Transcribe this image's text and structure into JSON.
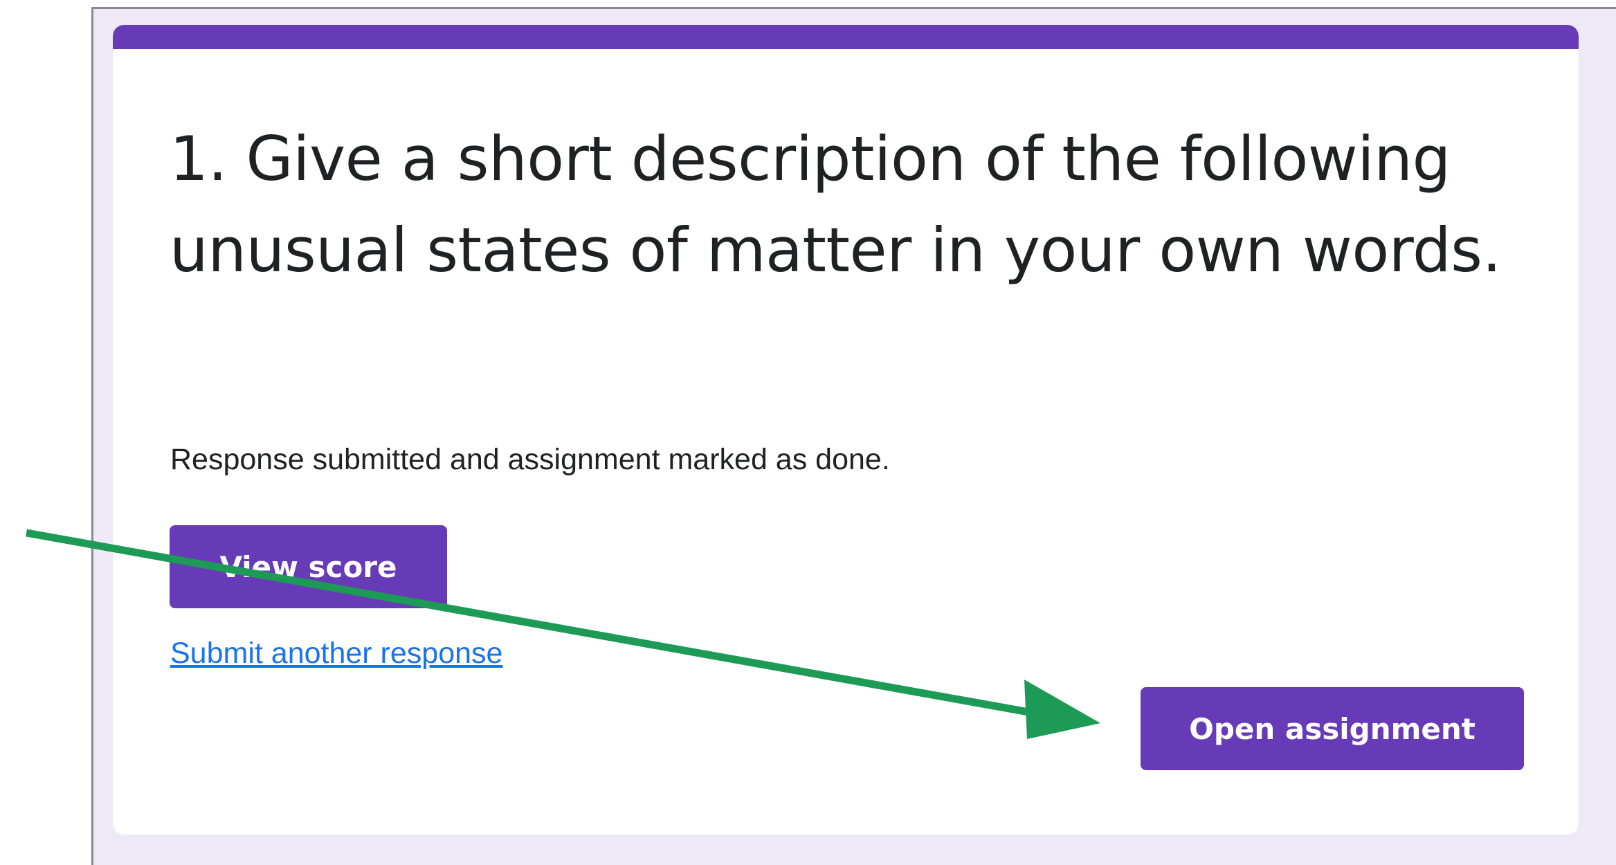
{
  "card": {
    "title": "1. Give a short description of the following unusual states of matter in your own words.",
    "status_message": "Response submitted and assignment marked as done.",
    "view_score_label": "View score",
    "submit_another_label": "Submit another response",
    "open_assignment_label": "Open assignment"
  },
  "colors": {
    "accent": "#673ab7",
    "link": "#1a73e8",
    "annotation_arrow": "#1e9a57",
    "frame_background": "#ede9f7"
  },
  "annotation": {
    "type": "arrow",
    "points_to": "open-assignment-button"
  }
}
